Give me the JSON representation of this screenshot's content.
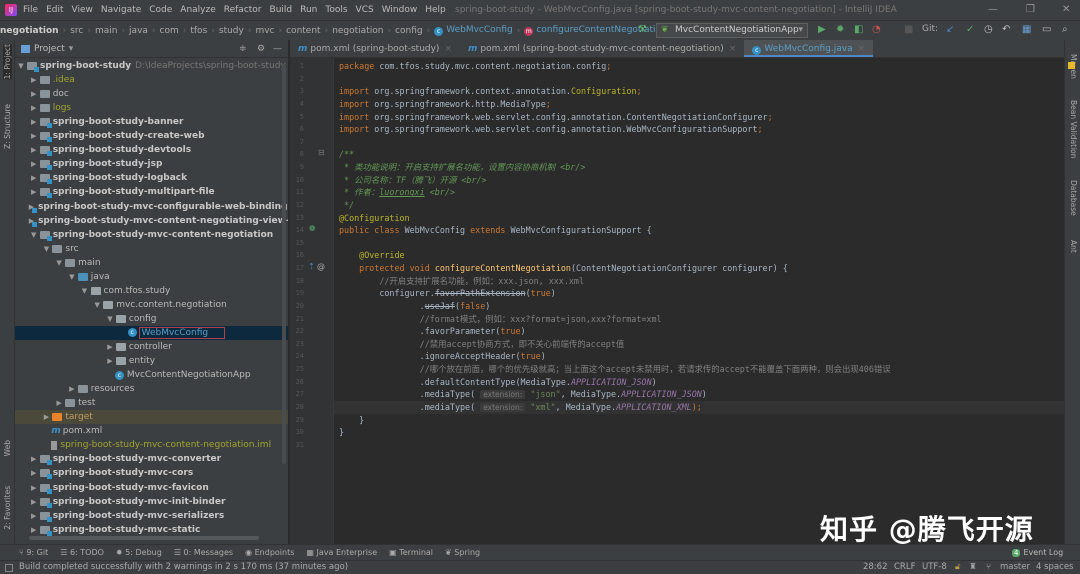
{
  "menubar": {
    "items": [
      "File",
      "Edit",
      "View",
      "Navigate",
      "Code",
      "Analyze",
      "Refactor",
      "Build",
      "Run",
      "Tools",
      "VCS",
      "Window",
      "Help"
    ],
    "window_title": "spring-boot-study - WebMvcConfig.java [spring-boot-study-mvc-content-negotiation] - IntelliJ IDEA"
  },
  "breadcrumbs": [
    "negotiation",
    "src",
    "main",
    "java",
    "com",
    "tfos",
    "study",
    "mvc",
    "content",
    "negotiation",
    "config",
    "WebMvcConfig",
    "configureContentNegotiation"
  ],
  "toolbar": {
    "run_config": "MvcContentNegotiationApp",
    "git_label": "Git:"
  },
  "project_panel": {
    "title": "Project"
  },
  "tree": [
    {
      "d": 0,
      "a": "▼",
      "ic": "mod",
      "label": "spring-boot-study",
      "cls": "b",
      "extra": "D:\\IdeaProjects\\spring-boot-study"
    },
    {
      "d": 1,
      "a": "▶",
      "ic": "",
      "label": ".idea",
      "cls": "y"
    },
    {
      "d": 1,
      "a": "▶",
      "ic": "",
      "label": "doc",
      "cls": ""
    },
    {
      "d": 1,
      "a": "▶",
      "ic": "",
      "label": "logs",
      "cls": "y"
    },
    {
      "d": 1,
      "a": "▶",
      "ic": "mod",
      "label": "spring-boot-study-banner",
      "cls": "b"
    },
    {
      "d": 1,
      "a": "▶",
      "ic": "mod",
      "label": "spring-boot-study-create-web",
      "cls": "b"
    },
    {
      "d": 1,
      "a": "▶",
      "ic": "mod",
      "label": "spring-boot-study-devtools",
      "cls": "b"
    },
    {
      "d": 1,
      "a": "▶",
      "ic": "mod",
      "label": "spring-boot-study-jsp",
      "cls": "b"
    },
    {
      "d": 1,
      "a": "▶",
      "ic": "mod",
      "label": "spring-boot-study-logback",
      "cls": "b"
    },
    {
      "d": 1,
      "a": "▶",
      "ic": "mod",
      "label": "spring-boot-study-multipart-file",
      "cls": "b"
    },
    {
      "d": 1,
      "a": "▶",
      "ic": "mod",
      "label": "spring-boot-study-mvc-configurable-web-binding-initializer",
      "cls": "b"
    },
    {
      "d": 1,
      "a": "▶",
      "ic": "mod",
      "label": "spring-boot-study-mvc-content-negotiating-view-resolver",
      "cls": "b"
    },
    {
      "d": 1,
      "a": "▼",
      "ic": "mod",
      "label": "spring-boot-study-mvc-content-negotiation",
      "cls": "b"
    },
    {
      "d": 2,
      "a": "▼",
      "ic": "",
      "label": "src",
      "cls": ""
    },
    {
      "d": 3,
      "a": "▼",
      "ic": "",
      "label": "main",
      "cls": ""
    },
    {
      "d": 4,
      "a": "▼",
      "ic": "src",
      "label": "java",
      "cls": ""
    },
    {
      "d": 5,
      "a": "▼",
      "ic": "pkg",
      "label": "com.tfos.study",
      "cls": ""
    },
    {
      "d": 6,
      "a": "▼",
      "ic": "pkg",
      "label": "mvc.content.negotiation",
      "cls": ""
    },
    {
      "d": 7,
      "a": "▼",
      "ic": "pkg",
      "label": "config",
      "cls": ""
    },
    {
      "d": 8,
      "a": "",
      "ic": "class",
      "label": "WebMvcConfig",
      "cls": "selected"
    },
    {
      "d": 7,
      "a": "▶",
      "ic": "pkg",
      "label": "controller",
      "cls": ""
    },
    {
      "d": 7,
      "a": "▶",
      "ic": "pkg",
      "label": "entity",
      "cls": ""
    },
    {
      "d": 7,
      "a": "",
      "ic": "class",
      "label": "MvcContentNegotiationApp",
      "cls": ""
    },
    {
      "d": 4,
      "a": "▶",
      "ic": "",
      "label": "resources",
      "cls": ""
    },
    {
      "d": 3,
      "a": "▶",
      "ic": "",
      "label": "test",
      "cls": ""
    },
    {
      "d": 2,
      "a": "▶",
      "ic": "orange",
      "label": "target",
      "cls": "o"
    },
    {
      "d": 2,
      "a": "",
      "ic": "maven",
      "label": "pom.xml",
      "cls": ""
    },
    {
      "d": 2,
      "a": "",
      "ic": "iml",
      "label": "spring-boot-study-mvc-content-negotiation.iml",
      "cls": "y"
    },
    {
      "d": 1,
      "a": "▶",
      "ic": "mod",
      "label": "spring-boot-study-mvc-converter",
      "cls": "b"
    },
    {
      "d": 1,
      "a": "▶",
      "ic": "mod",
      "label": "spring-boot-study-mvc-cors",
      "cls": "b"
    },
    {
      "d": 1,
      "a": "▶",
      "ic": "mod",
      "label": "spring-boot-study-mvc-favicon",
      "cls": "b"
    },
    {
      "d": 1,
      "a": "▶",
      "ic": "mod",
      "label": "spring-boot-study-mvc-init-binder",
      "cls": "b"
    },
    {
      "d": 1,
      "a": "▶",
      "ic": "mod",
      "label": "spring-boot-study-mvc-serializers",
      "cls": "b"
    },
    {
      "d": 1,
      "a": "▶",
      "ic": "mod",
      "label": "spring-boot-study-mvc-static",
      "cls": "b"
    }
  ],
  "editor_tabs": [
    {
      "label": "pom.xml (spring-boot-study)",
      "icon": "m"
    },
    {
      "label": "pom.xml (spring-boot-study-mvc-content-negotiation)",
      "icon": "m"
    },
    {
      "label": "WebMvcConfig.java",
      "icon": "c",
      "active": true
    }
  ],
  "code": [
    [
      [
        "package ",
        "kw"
      ],
      [
        "com.tfos.study.mvc.content.negotiation.config",
        ""
      ],
      [
        ";",
        "kw"
      ]
    ],
    [],
    [
      [
        "import ",
        "kw"
      ],
      [
        "org.springframework.context.annotation.",
        ""
      ],
      [
        "Configuration",
        "ann"
      ],
      [
        ";",
        "kw"
      ]
    ],
    [
      [
        "import ",
        "kw"
      ],
      [
        "org.springframework.http.MediaType",
        ""
      ],
      [
        ";",
        "kw"
      ]
    ],
    [
      [
        "import ",
        "kw"
      ],
      [
        "org.springframework.web.servlet.config.annotation.ContentNegotiationConfigurer",
        ""
      ],
      [
        ";",
        "kw"
      ]
    ],
    [
      [
        "import ",
        "kw"
      ],
      [
        "org.springframework.web.servlet.config.annotation.WebMvcConfigurationSupport",
        ""
      ],
      [
        ";",
        "kw"
      ]
    ],
    [],
    [
      [
        "/**",
        "doc"
      ]
    ],
    [
      [
        " * 类功能说明：开启支持扩展名功能，设置内容协商机制 <br/>",
        "doc"
      ]
    ],
    [
      [
        " * 公司名称：TF（腾飞）开源 <br/>",
        "doc"
      ]
    ],
    [
      [
        " * 作者：",
        "doc"
      ],
      [
        "luorongxi",
        "doc ul"
      ],
      [
        " <br/>",
        "doc"
      ]
    ],
    [
      [
        " */",
        "doc"
      ]
    ],
    [
      [
        "@Configuration",
        "ann"
      ]
    ],
    [
      [
        "public class ",
        "kw"
      ],
      [
        "WebMvcConfig ",
        ""
      ],
      [
        "extends ",
        "kw"
      ],
      [
        "WebMvcConfigurationSupport {",
        ""
      ]
    ],
    [],
    [
      [
        "    @Override",
        "ann"
      ]
    ],
    [
      [
        "    protected void ",
        "kw"
      ],
      [
        "configureContentNegotiation",
        "fn"
      ],
      [
        "(ContentNegotiationConfigurer configurer) {",
        ""
      ]
    ],
    [
      [
        "        //开启支持扩展名功能，例如：xxx.json, xxx.xml",
        "cm"
      ]
    ],
    [
      [
        "        configurer.",
        ""
      ],
      [
        "favorPathExtension",
        "depr"
      ],
      [
        "(",
        ""
      ],
      [
        "true",
        "kw"
      ],
      [
        ")",
        ""
      ]
    ],
    [
      [
        "                .",
        ""
      ],
      [
        "useJaf",
        "depr"
      ],
      [
        "(",
        ""
      ],
      [
        "false",
        "kw"
      ],
      [
        ")",
        ""
      ]
    ],
    [
      [
        "                //format模式，例如：xxx?format=json,xxx?format=xml",
        "cm"
      ]
    ],
    [
      [
        "                .favorParameter(",
        ""
      ],
      [
        "true",
        "kw"
      ],
      [
        ")",
        ""
      ]
    ],
    [
      [
        "                //禁用accept协商方式，即不关心前端传的accept值",
        "cm"
      ]
    ],
    [
      [
        "                .ignoreAcceptHeader(",
        ""
      ],
      [
        "true",
        "kw"
      ],
      [
        ")",
        ""
      ]
    ],
    [
      [
        "                //哪个放在前面，哪个的优先级就高；当上面这个accept未禁用时，若请求传的accept不能覆盖下面两种，则会出现406错误",
        "cm"
      ]
    ],
    [
      [
        "                .defaultContentType(MediaType.",
        ""
      ],
      [
        "APPLICATION_JSON",
        "cst"
      ],
      [
        ")",
        ""
      ]
    ],
    [
      [
        "                .mediaType( ",
        ""
      ],
      [
        "extension:",
        "hint"
      ],
      [
        " ",
        ""
      ],
      [
        "\"json\"",
        "str"
      ],
      [
        ", MediaType.",
        ""
      ],
      [
        "APPLICATION_JSON",
        "cst"
      ],
      [
        ")",
        ""
      ]
    ],
    [
      [
        "                .mediaType( ",
        ""
      ],
      [
        "extension:",
        "hint"
      ],
      [
        " ",
        ""
      ],
      [
        "\"xml\"",
        "str"
      ],
      [
        ", MediaType.",
        ""
      ],
      [
        "APPLICATION_XML",
        "cst"
      ],
      [
        ");",
        "kw"
      ]
    ],
    [
      [
        "    }",
        ""
      ]
    ],
    [
      [
        "}",
        ""
      ]
    ],
    []
  ],
  "right_strip": [
    "Maven",
    "Bean Validation",
    "Database",
    "Ant"
  ],
  "left_strip": [
    "1: Project",
    "Z: Structure",
    "Web",
    "2: Favorites"
  ],
  "bottom_tools": [
    "9: Git",
    "6: TODO",
    "5: Debug",
    "0: Messages",
    "Endpoints",
    "Java Enterprise",
    "Terminal",
    "Spring"
  ],
  "event_log": {
    "label": "Event Log",
    "count": "4"
  },
  "status": {
    "message": "Build completed successfully with 2 warnings in 2 s 170 ms (37 minutes ago)",
    "position": "28:62",
    "line_sep": "CRLF",
    "encoding": "UTF-8",
    "branch": "master",
    "indent": "4 spaces"
  },
  "watermark": "知乎 @腾飞开源"
}
